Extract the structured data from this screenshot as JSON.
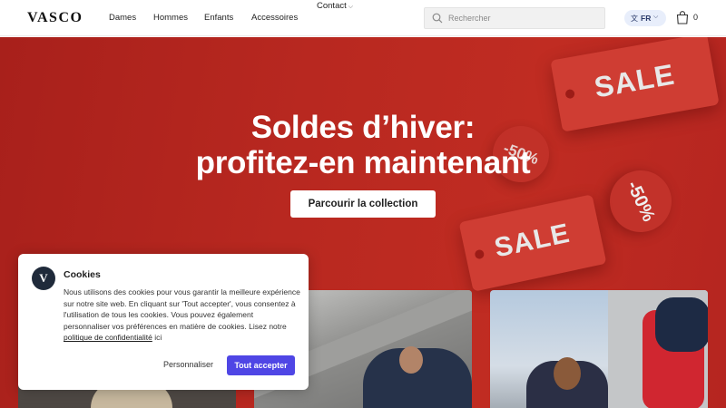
{
  "header": {
    "logo": "VASCO",
    "nav": [
      "Dames",
      "Hommes",
      "Enfants",
      "Accessoires"
    ],
    "contact_label": "Contact",
    "search_placeholder": "Rechercher",
    "language": "FR",
    "cart_count": "0"
  },
  "hero": {
    "title_line1": "Soldes d’hiver:",
    "title_line2": "profitez-en maintenant",
    "cta_label": "Parcourir la collection",
    "tag_text": "SALE",
    "discount_text": "-50%"
  },
  "cookie": {
    "avatar_letter": "V",
    "title": "Cookies",
    "body_text": "Nous utilisons des cookies pour vous garantir la meilleure expérience sur notre site web. En cliquant sur 'Tout accepter', vous consentez à l'utilisation de tous les cookies. Vous pouvez également personnaliser vos préférences en matière de cookies. Lisez notre",
    "link_text": "politique de confidentialité",
    "body_suffix": "ici",
    "personalize_label": "Personnaliser",
    "accept_label": "Tout accepter"
  },
  "colors": {
    "hero_red": "#b82820",
    "accept_button": "#4f46e5",
    "language_pill": "#e8eefb"
  },
  "icons": {
    "search": "search-icon",
    "language": "translate-icon",
    "cart": "shopping-bag-icon",
    "chevron": "chevron-down-icon"
  }
}
